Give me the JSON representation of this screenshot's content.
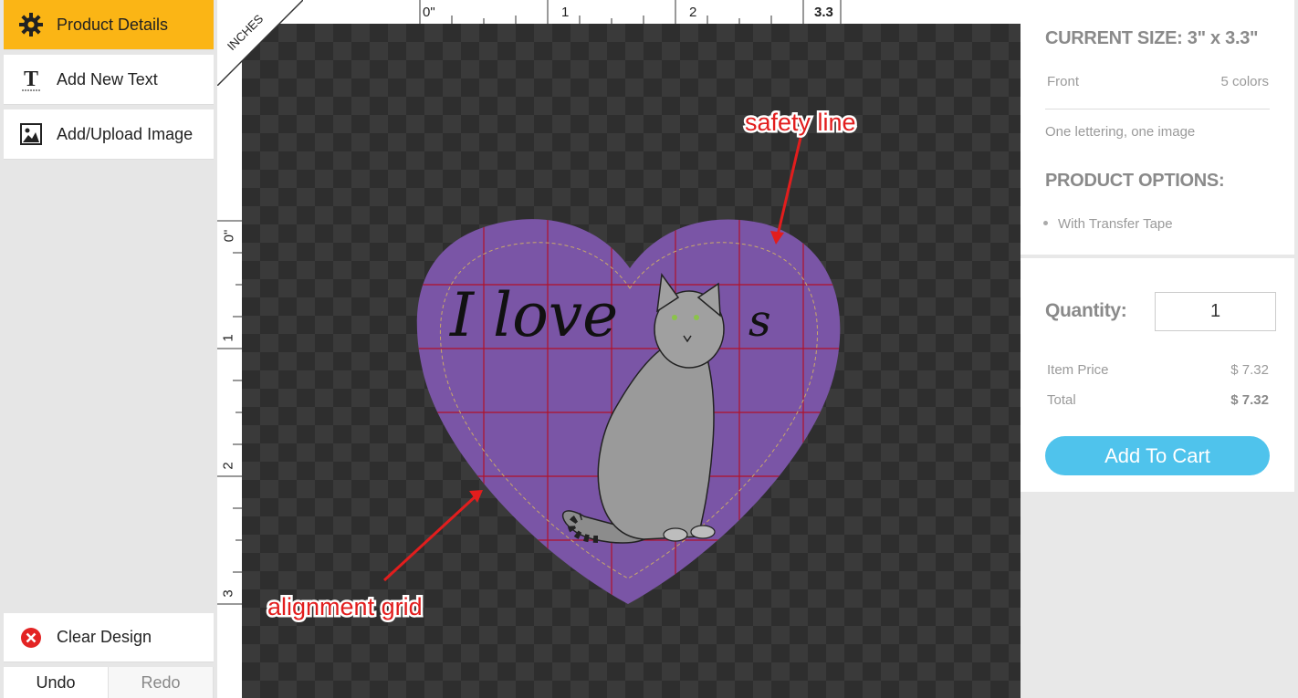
{
  "sidebar": {
    "product_details": "Product Details",
    "add_text": "Add New Text",
    "add_image": "Add/Upload Image",
    "clear_design": "Clear Design",
    "undo": "Undo",
    "redo": "Redo"
  },
  "ruler": {
    "units": "INCHES",
    "top_labels": [
      "0\"",
      "1",
      "2",
      "3.3"
    ],
    "left_labels": [
      "0\"",
      "1",
      "2",
      "3"
    ]
  },
  "design": {
    "text": "I love",
    "text_suffix": "s",
    "shape_color": "#7a55a6",
    "annotations": {
      "safety": "safety line",
      "grid": "alignment grid"
    }
  },
  "details": {
    "current_size": "CURRENT SIZE: 3\" x 3.3\"",
    "front_label": "Front",
    "front_colors": "5 colors",
    "description": "One lettering, one image",
    "options_heading": "PRODUCT OPTIONS:",
    "options": [
      "With Transfer Tape"
    ]
  },
  "order": {
    "quantity_label": "Quantity:",
    "quantity_value": "1",
    "item_price_label": "Item Price",
    "item_price": "$ 7.32",
    "total_label": "Total",
    "total": "$ 7.32",
    "add_to_cart": "Add To Cart"
  },
  "colors": {
    "accent": "#fbb515",
    "cart": "#4fc3ec",
    "grid": "#b1122a",
    "annotation": "#e21d1d"
  }
}
